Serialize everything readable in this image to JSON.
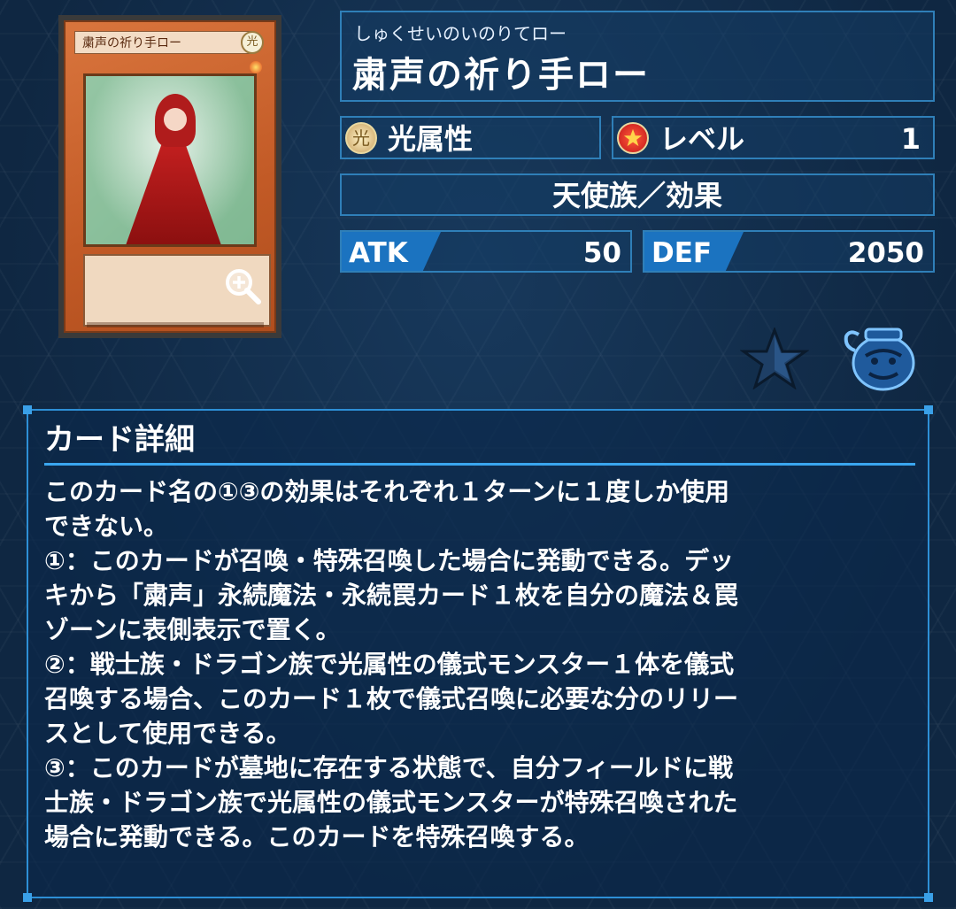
{
  "card_image": {
    "name_text": "粛声の祈り手ロー",
    "attribute_glyph": "光"
  },
  "card": {
    "ruby": "しゅくせいのいのりてロー",
    "name": "粛声の祈り手ロー",
    "attribute": {
      "icon": "light-attribute-icon",
      "label": "光属性"
    },
    "level": {
      "icon": "level-star-icon",
      "label": "レベル",
      "value": "1"
    },
    "type": "天使族／効果",
    "atk": {
      "label": "ATK",
      "value": "50"
    },
    "def": {
      "label": "DEF",
      "value": "2050"
    }
  },
  "actions": {
    "favorite_icon": "star-icon",
    "pot_icon": "pot-of-greed-icon",
    "zoom_icon": "zoom-in-icon"
  },
  "detail": {
    "title": "カード詳細",
    "lines": [
      "このカード名の①③の効果はそれぞれ１ターンに１度しか使用",
      "できない。",
      "①：このカードが召喚・特殊召喚した場合に発動できる。デッ",
      "キから「粛声」永続魔法・永続罠カード１枚を自分の魔法＆罠",
      "ゾーンに表側表示で置く。",
      "②：戦士族・ドラゴン族で光属性の儀式モンスター１体を儀式",
      "召喚する場合、このカード１枚で儀式召喚に必要な分のリリー",
      "スとして使用できる。",
      "③：このカードが墓地に存在する状態で、自分フィールドに戦",
      "士族・ドラゴン族で光属性の儀式モンスターが特殊召喚された",
      "場合に発動できる。このカードを特殊召喚する。"
    ]
  },
  "colors": {
    "panel_border": "#2f7fb8",
    "stat_label_bg": "#1b73c0",
    "detail_accent": "#3aa6ef",
    "background": "#0f2742"
  }
}
